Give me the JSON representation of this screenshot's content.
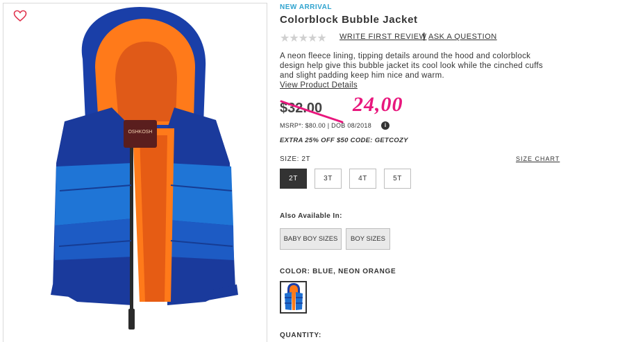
{
  "product": {
    "badge": "NEW ARRIVAL",
    "title": "Colorblock Bubble Jacket",
    "rating_stars": "★★★★★",
    "review_link": "WRITE FIRST REVIEW",
    "separator": "|",
    "ask_link": "ASK A QUESTION",
    "description": "A neon fleece lining, tipping details around the hood and colorblock design help give this bubble jacket its cool look while the cinched cuffs and slight padding keep him nice and warm.",
    "details_link": "View Product Details",
    "old_price": "$32.00",
    "handwritten_price": "24,00",
    "msrp": "MSRP*: $80.00 | DOB 08/2018",
    "info_icon": "i",
    "promo": "EXTRA 25% OFF $50 CODE: GETCOZY"
  },
  "size": {
    "label": "SIZE: 2T",
    "chart_link": "SIZE CHART",
    "options": [
      "2T",
      "3T",
      "4T",
      "5T"
    ],
    "selected": "2T"
  },
  "also_available": {
    "label": "Also Available In:",
    "options": [
      "BABY BOY SIZES",
      "BOY SIZES"
    ]
  },
  "color": {
    "label": "COLOR: BLUE, NEON ORANGE",
    "accent_blue": "#1f6fd1",
    "accent_orange": "#ff7a1a"
  },
  "quantity": {
    "label": "QUANTITY:"
  },
  "icons": {
    "favorite": "heart-outline-icon",
    "info": "info-icon"
  },
  "colors": {
    "sale_pink": "#e8177d",
    "badge_blue": "#2fa3cf"
  }
}
